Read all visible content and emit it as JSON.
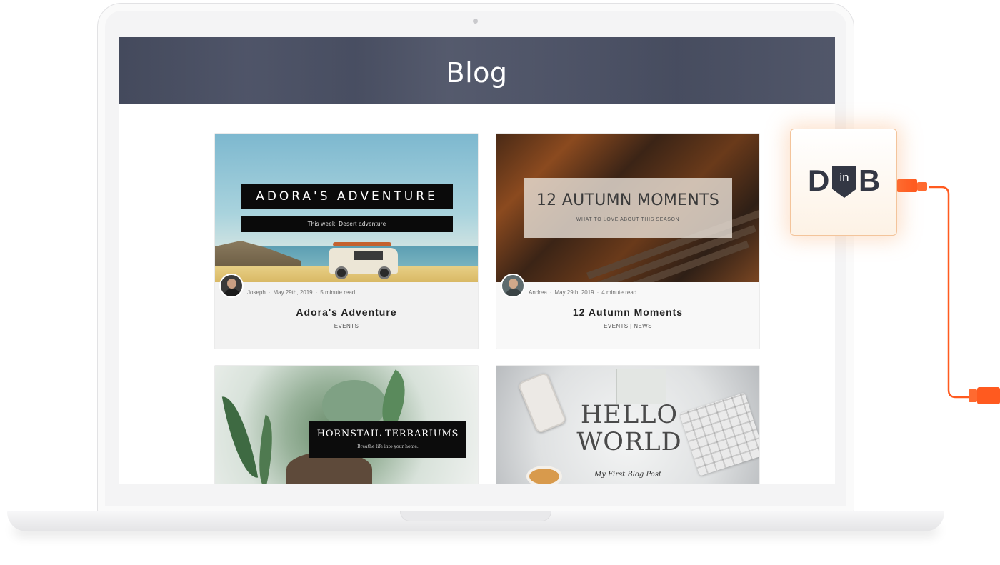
{
  "blog": {
    "title": "Blog"
  },
  "posts": [
    {
      "image_title": "ADORA'S ADVENTURE",
      "image_subtitle": "This week: Desert adventure",
      "author": "Joseph",
      "date": "May 29th, 2019",
      "read_time": "5 minute read",
      "title": "Adora's Adventure",
      "categories": "EVENTS"
    },
    {
      "image_title": "12 AUTUMN MOMENTS",
      "image_subtitle": "WHAT TO LOVE ABOUT THIS SEASON",
      "author": "Andrea",
      "date": "May 29th, 2019",
      "read_time": "4 minute read",
      "title": "12 Autumn Moments",
      "categories": "EVENTS | NEWS"
    },
    {
      "image_title": "HORNSTAIL TERRARIUMS",
      "image_subtitle": "Breathe life into your home."
    },
    {
      "image_title_line1": "HELLO",
      "image_title_line2": "WORLD",
      "image_subtitle": "My First Blog Post"
    }
  ],
  "badge": {
    "letter_left": "D",
    "letter_middle": "in",
    "letter_right": "B"
  },
  "colors": {
    "hero_overlay": "#464c60",
    "card_background": "#f2f2f2",
    "cable": "#ff5a1f",
    "badge_text": "#333744"
  },
  "icons": [
    "laptop-camera-icon",
    "usb-connector-icon",
    "dinb-logo-icon"
  ]
}
